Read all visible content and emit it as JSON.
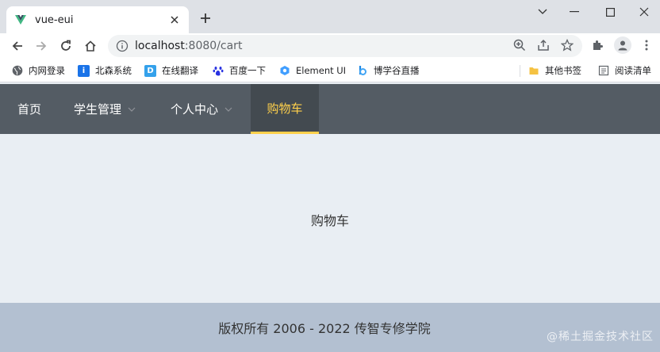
{
  "browser": {
    "tab_title": "vue-eui",
    "url_host": "localhost",
    "url_rest": ":8080/cart"
  },
  "bookmarks": [
    {
      "label": "内网登录",
      "icon": "globe-icon",
      "color": "#5f6368"
    },
    {
      "label": "北森系统",
      "icon": "beisen-icon",
      "color": "#1a73e8"
    },
    {
      "label": "在线翻译",
      "icon": "translate-icon",
      "color": "#34a1eb"
    },
    {
      "label": "百度一下",
      "icon": "baidu-paw-icon",
      "color": "#2932e1"
    },
    {
      "label": "Element UI",
      "icon": "element-icon",
      "color": "#409eff"
    },
    {
      "label": "博学谷直播",
      "icon": "boxuegu-icon",
      "color": "#1e88e5"
    }
  ],
  "bookmarks_right": [
    {
      "label": "其他书签",
      "icon": "folder-icon",
      "color": "#f5c242"
    },
    {
      "label": "阅读清单",
      "icon": "reading-list-icon",
      "color": "#5f6368"
    }
  ],
  "nav": {
    "home": "首页",
    "students": "学生管理",
    "profile": "个人中心",
    "cart": "购物车"
  },
  "main": {
    "content": "购物车"
  },
  "footer": {
    "copyright": "版权所有 2006 - 2022 传智专修学院"
  },
  "watermark": "@稀土掘金技术社区",
  "colors": {
    "nav_bg": "#545c64",
    "nav_active_bg": "#434a50",
    "nav_active_text": "#ffd04b",
    "main_bg": "#e9eef3",
    "footer_bg": "#b3c0d1"
  }
}
